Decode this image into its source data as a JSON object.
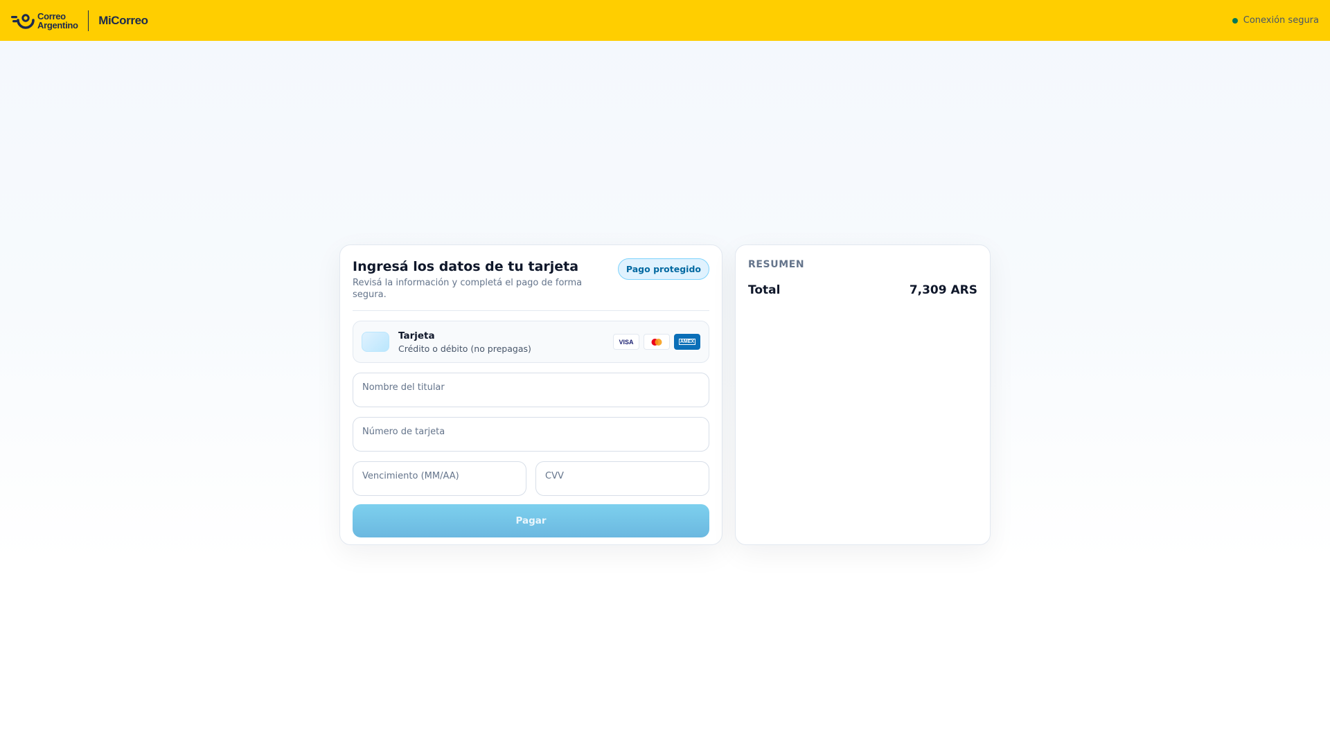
{
  "header": {
    "logo_line1": "Correo",
    "logo_line2": "Argentino",
    "product": "MiCorreo",
    "secure_label": "Conexión segura",
    "brand_color": "#ffce00"
  },
  "payment": {
    "title": "Ingresá los datos de tu tarjeta",
    "subtitle": "Revisá la información y completá el pago de forma segura.",
    "badge": "Pago protegido",
    "method": {
      "label": "Tarjeta",
      "description": "Crédito o débito (no prepagas)",
      "brands": [
        "VISA",
        "mastercard-icon",
        "AMEX"
      ]
    },
    "fields": {
      "holder_placeholder": "Nombre del titular",
      "number_placeholder": "Número de tarjeta",
      "expiry_placeholder": "Vencimiento (MM/AA)",
      "cvv_placeholder": "CVV"
    },
    "submit_label": "Pagar"
  },
  "summary": {
    "title": "RESUMEN",
    "total_label": "Total",
    "total_value": "7,309 ARS"
  }
}
